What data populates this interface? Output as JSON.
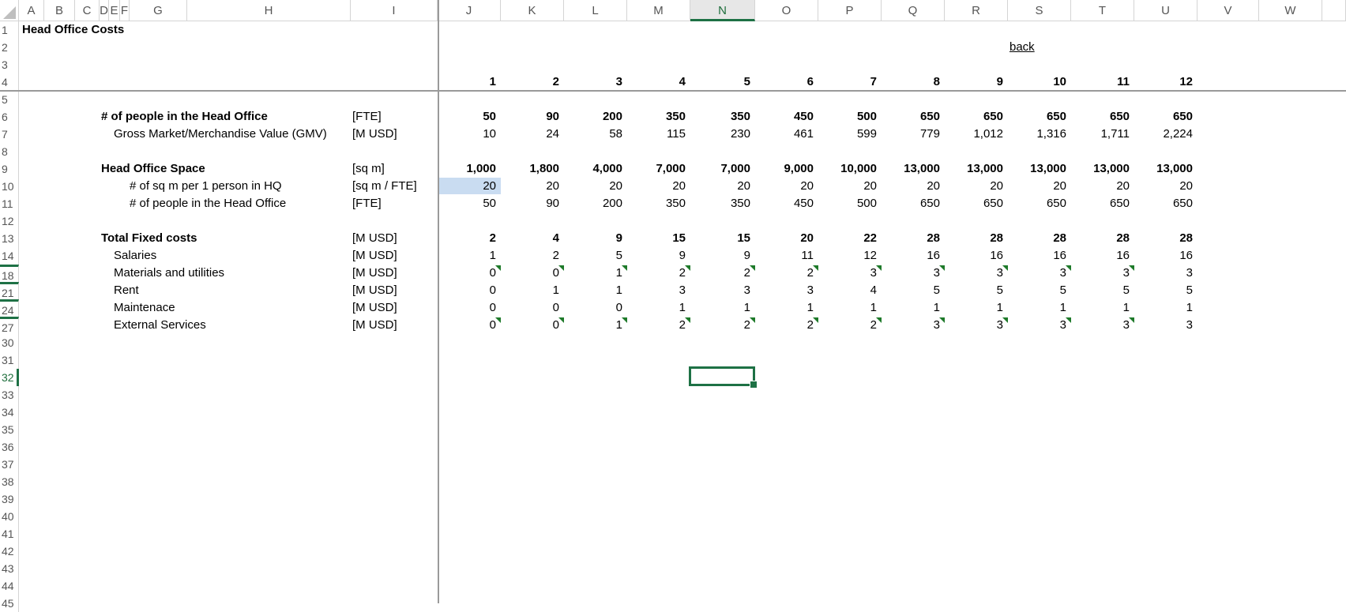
{
  "column_letters": [
    "A",
    "B",
    "C",
    "D",
    "E",
    "F",
    "G",
    "H",
    "I",
    "J",
    "K",
    "L",
    "M",
    "N",
    "O",
    "P",
    "Q",
    "R",
    "S",
    "T",
    "U",
    "V",
    "W"
  ],
  "active_column": "N",
  "row_numbers": [
    "1",
    "2",
    "3",
    "4",
    "5",
    "6",
    "7",
    "8",
    "9",
    "10",
    "11",
    "12",
    "13",
    "14",
    "18",
    "21",
    "24",
    "27",
    "30",
    "31",
    "32",
    "33",
    "34",
    "35",
    "36",
    "37",
    "38",
    "39",
    "40",
    "41",
    "42",
    "43",
    "44",
    "45"
  ],
  "active_row": "32",
  "sheet": {
    "title": "Head Office Costs",
    "back_link": "back",
    "periods": [
      "1",
      "2",
      "3",
      "4",
      "5",
      "6",
      "7",
      "8",
      "9",
      "10",
      "11",
      "12"
    ],
    "rows": [
      {
        "label": "# of people in the Head Office",
        "unit": "[FTE]",
        "values": [
          "50",
          "90",
          "200",
          "350",
          "350",
          "450",
          "500",
          "650",
          "650",
          "650",
          "650",
          "650"
        ]
      },
      {
        "label": "Gross Market/Merchandise Value (GMV)",
        "unit": "[M USD]",
        "values": [
          "10",
          "24",
          "58",
          "115",
          "230",
          "461",
          "599",
          "779",
          "1,012",
          "1,316",
          "1,711",
          "2,224"
        ]
      },
      {
        "label": "Head Office Space",
        "unit": "[sq m]",
        "values": [
          "1,000",
          "1,800",
          "4,000",
          "7,000",
          "7,000",
          "9,000",
          "10,000",
          "13,000",
          "13,000",
          "13,000",
          "13,000",
          "13,000"
        ]
      },
      {
        "label": "# of sq m per 1 person in HQ",
        "unit": "[sq m / FTE]",
        "values": [
          "20",
          "20",
          "20",
          "20",
          "20",
          "20",
          "20",
          "20",
          "20",
          "20",
          "20",
          "20"
        ]
      },
      {
        "label": "# of people in the Head Office",
        "unit": "[FTE]",
        "values": [
          "50",
          "90",
          "200",
          "350",
          "350",
          "450",
          "500",
          "650",
          "650",
          "650",
          "650",
          "650"
        ]
      },
      {
        "label": "Total Fixed costs",
        "unit": "[M USD]",
        "values": [
          "2",
          "4",
          "9",
          "15",
          "15",
          "20",
          "22",
          "28",
          "28",
          "28",
          "28",
          "28"
        ]
      },
      {
        "label": "Salaries",
        "unit": "[M USD]",
        "values": [
          "1",
          "2",
          "5",
          "9",
          "9",
          "11",
          "12",
          "16",
          "16",
          "16",
          "16",
          "16"
        ]
      },
      {
        "label": "Materials and utilities",
        "unit": "[M USD]",
        "values": [
          "0",
          "0",
          "1",
          "2",
          "2",
          "2",
          "3",
          "3",
          "3",
          "3",
          "3",
          "3"
        ]
      },
      {
        "label": "Rent",
        "unit": "[M USD]",
        "values": [
          "0",
          "1",
          "1",
          "3",
          "3",
          "3",
          "4",
          "5",
          "5",
          "5",
          "5",
          "5"
        ]
      },
      {
        "label": "Maintenace",
        "unit": "[M USD]",
        "values": [
          "0",
          "0",
          "0",
          "1",
          "1",
          "1",
          "1",
          "1",
          "1",
          "1",
          "1",
          "1"
        ]
      },
      {
        "label": "External Services",
        "unit": "[M USD]",
        "values": [
          "0",
          "0",
          "1",
          "2",
          "2",
          "2",
          "2",
          "3",
          "3",
          "3",
          "3",
          "3"
        ]
      }
    ]
  },
  "colors": {
    "accent_green": "#1e7145",
    "highlight_blue": "#c9dcf1",
    "comment_marker": "#1e7a2a",
    "link": "#0000ee"
  }
}
